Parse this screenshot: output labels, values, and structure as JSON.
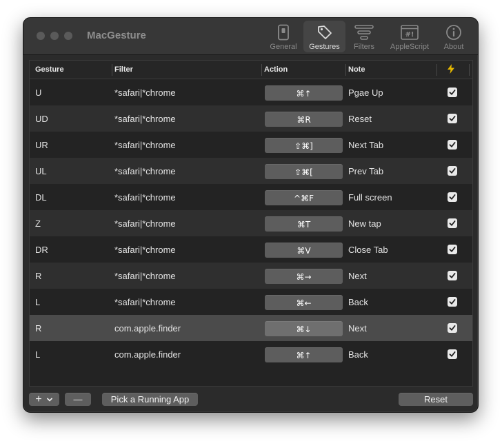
{
  "window": {
    "title": "MacGesture"
  },
  "toolbar": {
    "items": [
      {
        "label": "General",
        "icon": "phone-icon",
        "active": false
      },
      {
        "label": "Gestures",
        "icon": "tag-icon",
        "active": true
      },
      {
        "label": "Filters",
        "icon": "filter-icon",
        "active": false
      },
      {
        "label": "AppleScript",
        "icon": "script-icon",
        "active": false
      },
      {
        "label": "About",
        "icon": "info-icon",
        "active": false
      }
    ]
  },
  "table": {
    "columns": {
      "gesture": "Gesture",
      "filter": "Filter",
      "action": "Action",
      "note": "Note",
      "enabled_icon": "lightning-icon"
    },
    "rows": [
      {
        "gesture": "U",
        "filter": "*safari|*chrome",
        "action": "⌘↑",
        "note": "Pgae Up",
        "enabled": true
      },
      {
        "gesture": "UD",
        "filter": "*safari|*chrome",
        "action": "⌘R",
        "note": "Reset",
        "enabled": true
      },
      {
        "gesture": "UR",
        "filter": "*safari|*chrome",
        "action": "⇧⌘]",
        "note": "Next Tab",
        "enabled": true
      },
      {
        "gesture": "UL",
        "filter": "*safari|*chrome",
        "action": "⇧⌘[",
        "note": "Prev Tab",
        "enabled": true
      },
      {
        "gesture": "DL",
        "filter": "*safari|*chrome",
        "action": "^⌘F",
        "note": "Full screen",
        "enabled": true
      },
      {
        "gesture": "Z",
        "filter": "*safari|*chrome",
        "action": "⌘T",
        "note": "New tap",
        "enabled": true
      },
      {
        "gesture": "DR",
        "filter": "*safari|*chrome",
        "action": "⌘V",
        "note": "Close Tab",
        "enabled": true
      },
      {
        "gesture": "R",
        "filter": "*safari|*chrome",
        "action": "⌘→",
        "note": "Next",
        "enabled": true
      },
      {
        "gesture": "L",
        "filter": "*safari|*chrome",
        "action": "⌘←",
        "note": "Back",
        "enabled": true
      },
      {
        "gesture": "R",
        "filter": "com.apple.finder",
        "action": "⌘↓",
        "note": "Next",
        "enabled": true,
        "selected": true
      },
      {
        "gesture": "L",
        "filter": "com.apple.finder",
        "action": "⌘↑",
        "note": "Back",
        "enabled": true
      }
    ]
  },
  "bottom": {
    "add_label": "+",
    "remove_label": "—",
    "pick_label": "Pick a Running App",
    "reset_label": "Reset"
  },
  "colors": {
    "window_bg": "#2b2b2b",
    "row_alt": "#2f2f2f",
    "row_selected": "#4b4b4b",
    "button": "#5d5d5d"
  }
}
